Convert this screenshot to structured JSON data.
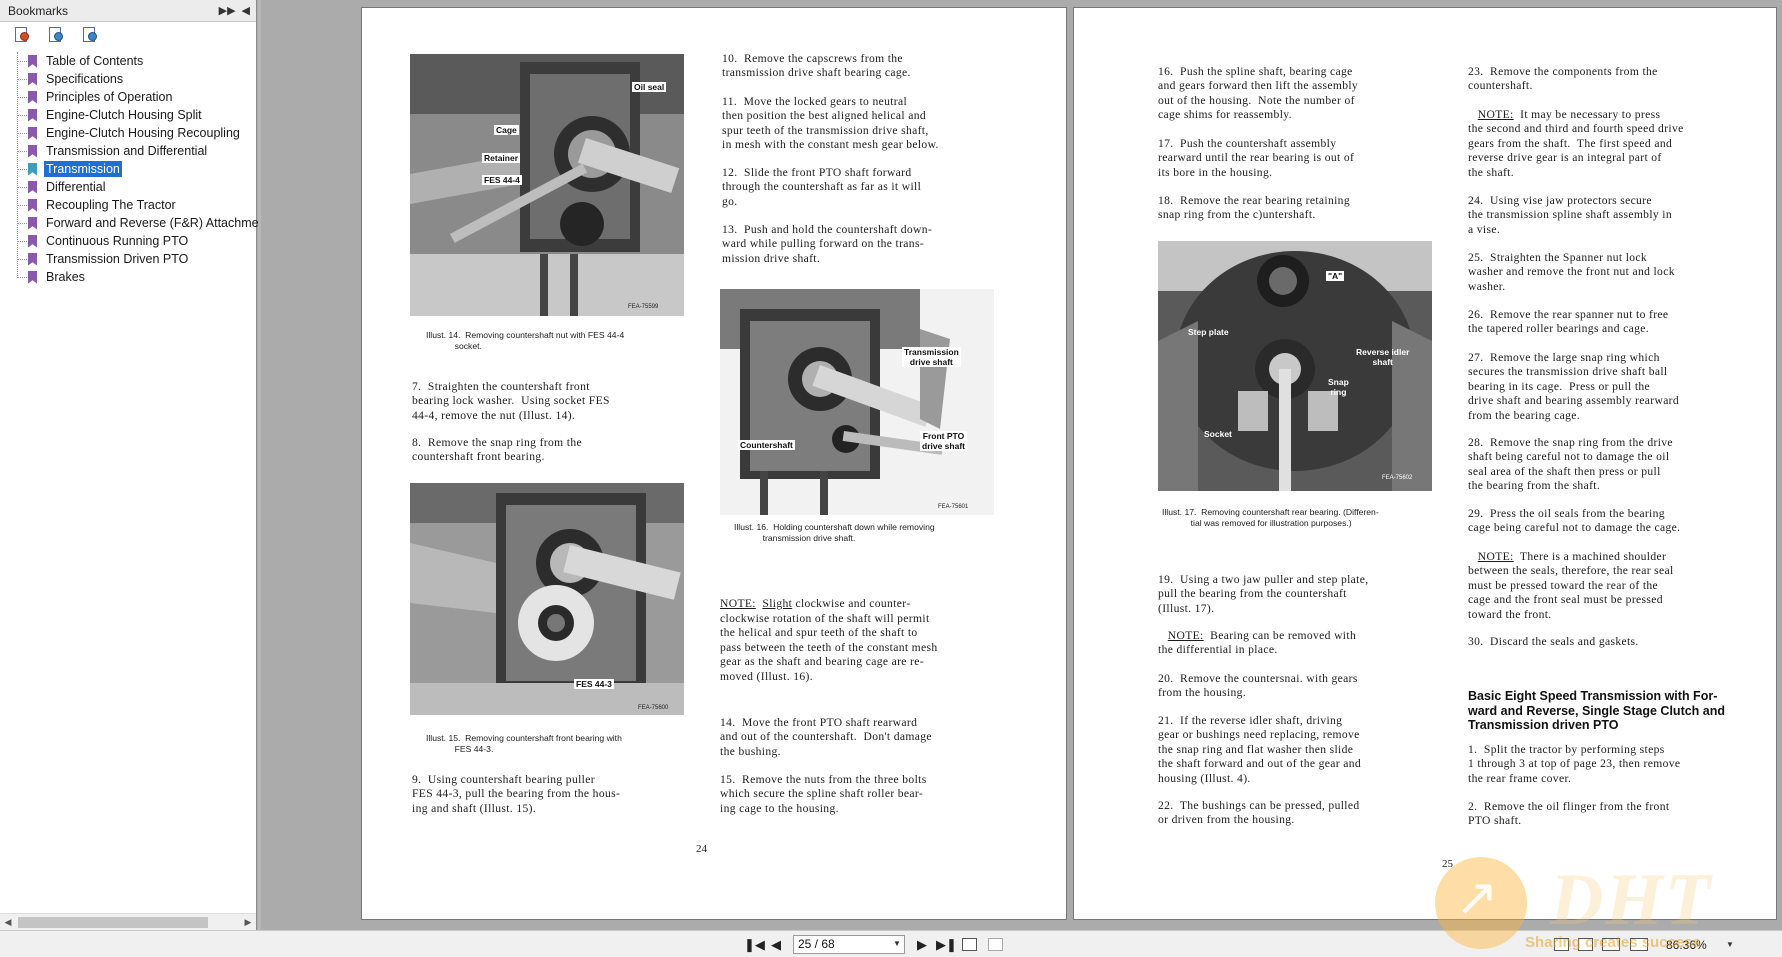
{
  "bookmarks": {
    "title": "Bookmarks",
    "items": [
      {
        "label": "Table of Contents"
      },
      {
        "label": "Specifications"
      },
      {
        "label": "Principles of Operation"
      },
      {
        "label": "Engine-Clutch Housing Split"
      },
      {
        "label": "Engine-Clutch Housing Recoupling"
      },
      {
        "label": "Transmission and Differential"
      },
      {
        "label": "Transmission"
      },
      {
        "label": "Differential"
      },
      {
        "label": "Recoupling The Tractor"
      },
      {
        "label": "Forward and Reverse (F&R) Attachme"
      },
      {
        "label": "Continuous Running PTO"
      },
      {
        "label": "Transmission Driven PTO"
      },
      {
        "label": "Brakes"
      }
    ],
    "active_index": 6
  },
  "page24": {
    "illust14_labels": {
      "oil_seal": "Oil seal",
      "cage": "Cage",
      "retainer": "Retainer",
      "fes": "FES 44-4",
      "code": "FEA-75599"
    },
    "illust14_caption": "Illust. 14.  Removing countershaft nut with FES 44-4\n            socket.",
    "step7": "7.  Straighten the countershaft front\nbearing lock washer.  Using socket FES\n44-4, remove the nut (Illust. 14).",
    "step8": "8.  Remove the snap ring from the\ncountershaft front bearing.",
    "illust15_labels": {
      "fes": "FES 44-3",
      "code": "FEA-75600"
    },
    "illust15_caption": "Illust. 15.  Removing countershaft front bearing with\n            FES 44-3.",
    "step9": "9.  Using countershaft bearing puller\nFES 44-3, pull the bearing from the hous-\ning and shaft (Illust. 15).",
    "step10": "10.  Remove the capscrews from the\ntransmission drive shaft bearing cage.",
    "step11": "11.  Move the locked gears to neutral\nthen position the best aligned helical and\nspur teeth of the transmission drive shaft,\nin mesh with the constant mesh gear below.",
    "step12": "12.  Slide the front PTO shaft forward\nthrough the countershaft as far as it will\ngo.",
    "step13": "13.  Push and hold the countershaft down-\nward while pulling forward on the trans-\nmission drive shaft.",
    "illust16_labels": {
      "transmission": "Transmission\ndrive shaft",
      "countershaft": "Countershaft",
      "front_pto": "Front PTO\ndrive shaft",
      "code": "FEA-75601"
    },
    "illust16_caption": "Illust. 16.  Holding countershaft down while removing\n            transmission drive shaft.",
    "note_label": "NOTE:",
    "note_word": "Slight",
    "note_rest": " clockwise and counter-",
    "note_body": "clockwise rotation of the shaft will permit\nthe helical and spur teeth of the shaft to\npass between the teeth of the constant mesh\ngear as the shaft and bearing cage are re-\nmoved (Illust. 16).",
    "step14": "14.  Move the front PTO shaft rearward\nand out of the countershaft.  Don't damage\nthe bushing.",
    "step15": "15.  Remove the nuts from the three bolts\nwhich secure the spline shaft roller bear-\ning cage to the housing.",
    "number": "24"
  },
  "page25": {
    "step16": "16.  Push the spline shaft, bearing cage\nand gears forward then lift the assembly\nout of the housing.  Note the number of\ncage shims for reassembly.",
    "step17": "17.  Push the countershaft assembly\nrearward until the rear bearing is out of\nits bore in the housing.",
    "step18": "18.  Remove the rear bearing retaining\nsnap ring from the c)untershaft.",
    "illust17_labels": {
      "a": "\"A\"",
      "step_plate": "Step plate",
      "reverse_idler": "Reverse idler\nshaft",
      "snap_ring": "Snap\nring",
      "socket": "Socket",
      "code": "FEA-75602"
    },
    "illust17_caption": "Illust. 17.  Removing countershaft rear bearing. (Differen-\n            tial was removed for illustration purposes.)",
    "step19": "19.  Using a two jaw puller and step plate,\npull the bearing from the countershaft\n(Illust. 17).",
    "note1_label": "NOTE:",
    "note1_rest": "  Bearing can be removed with\nthe differential in place.",
    "step20": "20.  Remove the countersnai. with gears\nfrom the housing.",
    "step21": "21.  If the reverse idler shaft, driving\ngear or bushings need replacing, remove\nthe snap ring and flat washer then slide\nthe shaft forward and out of the gear and\nhousing (Illust. 4).",
    "step22": "22.  The bushings can be pressed, pulled\nor driven from the housing.",
    "step23": "23.  Remove the components from the\ncountershaft.",
    "note2_label": "NOTE:",
    "note2_rest": "  It may be necessary to press\nthe second and third and fourth speed drive\ngears from the shaft.  The first speed and\nreverse drive gear is an integral part of\nthe shaft.",
    "step24": "24.  Using vise jaw protectors secure\nthe transmission spline shaft assembly in\na vise.",
    "step25": "25.  Straighten the Spanner nut lock\nwasher and remove the front nut and lock\nwasher.",
    "step26": "26.  Remove the rear spanner nut to free\nthe tapered roller bearings and cage.",
    "step27": "27.  Remove the large snap ring which\nsecures the transmission drive shaft ball\nbearing in its cage.  Press or pull the\ndrive shaft and bearing assembly rearward\nfrom the bearing cage.",
    "step28": "28.  Remove the snap ring from the drive\nshaft being careful not to damage the oil\nseal area of the shaft then press or pull\nthe bearing from the shaft.",
    "step29": "29.  Press the oil seals from the bearing\ncage being careful not to damage the cage.",
    "note3_label": "NOTE:",
    "note3_rest": "  There is a machined shoulder\nbetween the seals, therefore, the rear seal\nmust be pressed toward the rear of the\ncage and the front seal must be pressed\ntoward the front.",
    "step30": "30.  Discard the seals and gaskets.",
    "heading": "Basic Eight Speed Transmission with For-\nward and Reverse, Single Stage Clutch and\nTransmission driven PTO",
    "step_b1": "1.  Split the tractor by performing steps\n1 through 3 at top of page 23, then remove\nthe rear frame cover.",
    "step_b2": "2.  Remove the oil flinger from the front\nPTO shaft.",
    "number": "25"
  },
  "statusbar": {
    "page_field": "25 / 68",
    "zoom": "86.36%"
  },
  "watermark": {
    "logo": "DHT",
    "slogan": "Sharing creates success"
  }
}
